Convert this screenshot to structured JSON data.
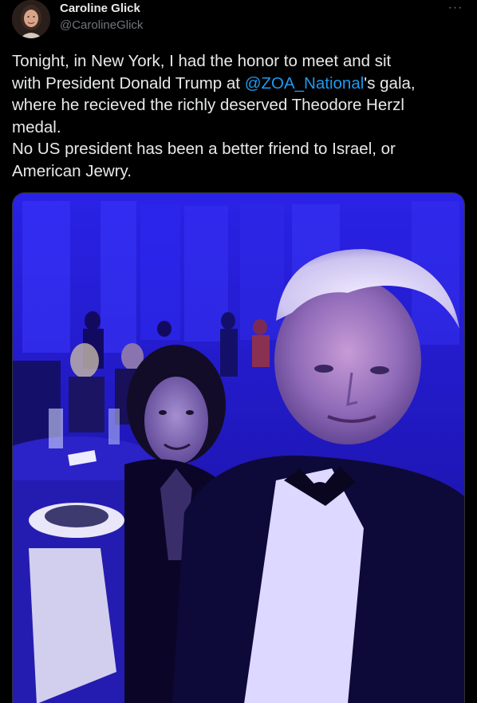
{
  "tweet": {
    "author": {
      "display_name": "Caroline Glick",
      "handle": "@CarolineGlick",
      "avatar_icon": "user-avatar-photo"
    },
    "more_label": "···",
    "text": {
      "line1": "Tonight, in New York, I had the honor to meet and sit",
      "line2_pre": "with President Donald Trump at ",
      "mention": "@ZOA_National",
      "line2_post": "'s gala,",
      "line3": "where he recieved the richly deserved Theodore Herzl",
      "line4": "medal.",
      "line5": "No US president has been a better friend to Israel, or",
      "line6": "American Jewry."
    },
    "media": {
      "type": "photo",
      "icon": "photo-icon"
    }
  },
  "colors": {
    "background": "#000000",
    "text": "#e7e9ea",
    "secondary_text": "#71767b",
    "link": "#1d9bf0",
    "photo_ambient": "#2a1bd6"
  }
}
